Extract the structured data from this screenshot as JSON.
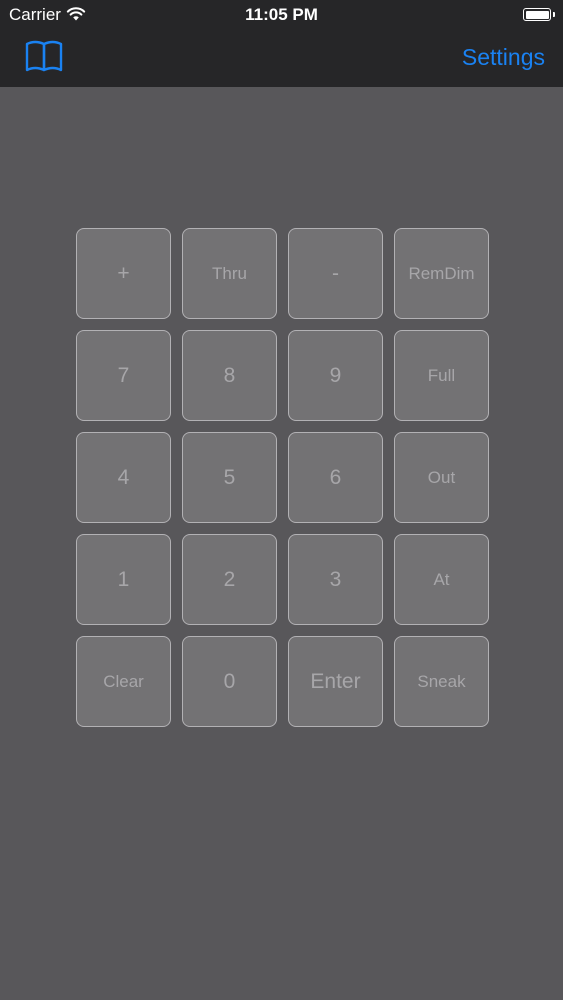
{
  "status_bar": {
    "carrier": "Carrier",
    "time": "11:05 PM",
    "wifi_icon": "wifi-icon",
    "battery_icon": "battery-icon"
  },
  "nav": {
    "left_icon": "book-icon",
    "settings_label": "Settings"
  },
  "colors": {
    "accent": "#1a82f2",
    "background": "#58575a",
    "topbar": "#262628",
    "key_fill": "#737274",
    "key_border": "#b2b1b4",
    "key_text": "#a7a6a9"
  },
  "keypad": {
    "keys": [
      {
        "label": "+",
        "kind": "num"
      },
      {
        "label": "Thru",
        "kind": "word"
      },
      {
        "label": "-",
        "kind": "num"
      },
      {
        "label": "RemDim",
        "kind": "word"
      },
      {
        "label": "7",
        "kind": "num"
      },
      {
        "label": "8",
        "kind": "num"
      },
      {
        "label": "9",
        "kind": "num"
      },
      {
        "label": "Full",
        "kind": "word"
      },
      {
        "label": "4",
        "kind": "num"
      },
      {
        "label": "5",
        "kind": "num"
      },
      {
        "label": "6",
        "kind": "num"
      },
      {
        "label": "Out",
        "kind": "word"
      },
      {
        "label": "1",
        "kind": "num"
      },
      {
        "label": "2",
        "kind": "num"
      },
      {
        "label": "3",
        "kind": "num"
      },
      {
        "label": "At",
        "kind": "word"
      },
      {
        "label": "Clear",
        "kind": "word"
      },
      {
        "label": "0",
        "kind": "num"
      },
      {
        "label": "Enter",
        "kind": "num"
      },
      {
        "label": "Sneak",
        "kind": "word"
      }
    ]
  }
}
